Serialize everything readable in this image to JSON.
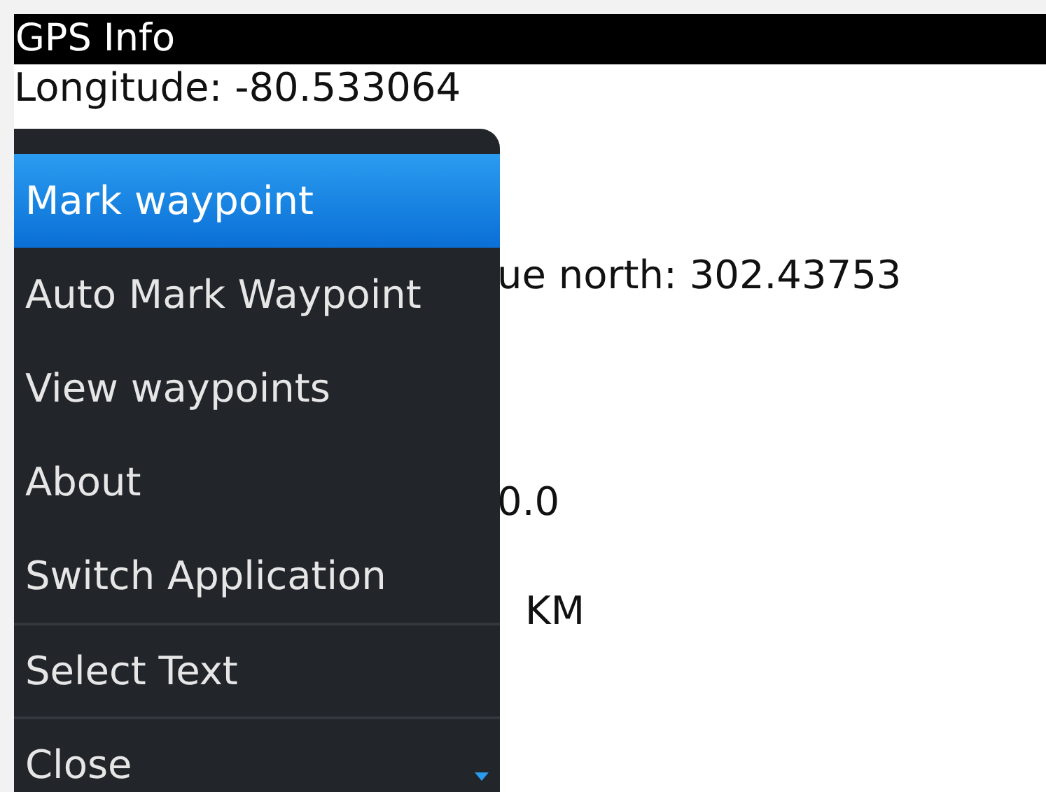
{
  "window": {
    "title": "GPS Info"
  },
  "info_lines": [
    {
      "text": "Longitude: -80.533064",
      "kind": "full"
    },
    {
      "text": "ue north: 302.43753",
      "kind": "covered"
    },
    {
      "text": "0.0",
      "kind": "covered"
    },
    {
      "text": "KM",
      "kind": "covered"
    }
  ],
  "menu": {
    "more_below": true,
    "items": [
      {
        "label": "Mark waypoint",
        "selected": true,
        "divider_before": false
      },
      {
        "label": "Auto Mark Waypoint",
        "selected": false,
        "divider_before": false
      },
      {
        "label": "View waypoints",
        "selected": false,
        "divider_before": false
      },
      {
        "label": "About",
        "selected": false,
        "divider_before": false
      },
      {
        "label": "Switch Application",
        "selected": false,
        "divider_before": false
      },
      {
        "label": "Select Text",
        "selected": false,
        "divider_before": true
      },
      {
        "label": "Close",
        "selected": false,
        "divider_before": true
      }
    ]
  }
}
